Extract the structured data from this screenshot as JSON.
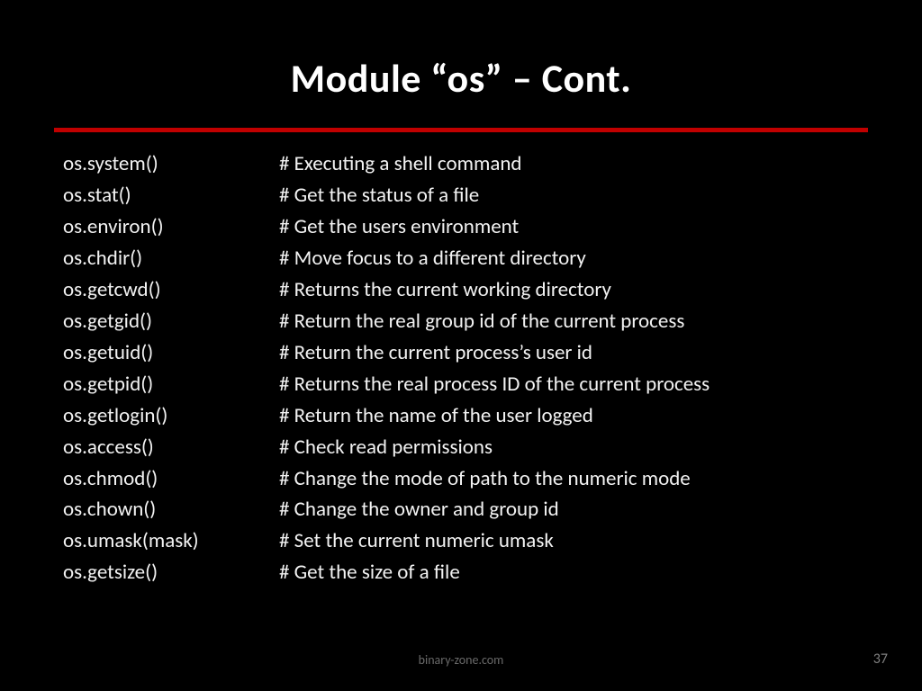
{
  "title": "Module “os” – Cont.",
  "rows": [
    {
      "fn": "os.system()",
      "desc": "# Executing a shell command"
    },
    {
      "fn": "os.stat()",
      "desc": "# Get the status of a file"
    },
    {
      "fn": "os.environ()",
      "desc": "# Get the users environment"
    },
    {
      "fn": "os.chdir()",
      "desc": "# Move focus to a different directory"
    },
    {
      "fn": "os.getcwd()",
      "desc": "# Returns the current working directory"
    },
    {
      "fn": "os.getgid()",
      "desc": "# Return the real group id of the current process"
    },
    {
      "fn": "os.getuid()",
      "desc": "# Return the current process’s user id"
    },
    {
      "fn": "os.getpid()",
      "desc": "# Returns the real process ID of the current process"
    },
    {
      "fn": "os.getlogin()",
      "desc": "# Return the name of the user logged"
    },
    {
      "fn": "os.access()",
      "desc": "# Check read permissions"
    },
    {
      "fn": "os.chmod()",
      "desc": "# Change the mode of path to the numeric mode"
    },
    {
      "fn": "os.chown()",
      "desc": "# Change the owner and group id"
    },
    {
      "fn": "os.umask(mask)",
      "desc": "# Set the current numeric umask"
    },
    {
      "fn": "os.getsize()",
      "desc": "# Get the size of a file"
    }
  ],
  "footer": "binary-zone.com",
  "page_number": "37"
}
